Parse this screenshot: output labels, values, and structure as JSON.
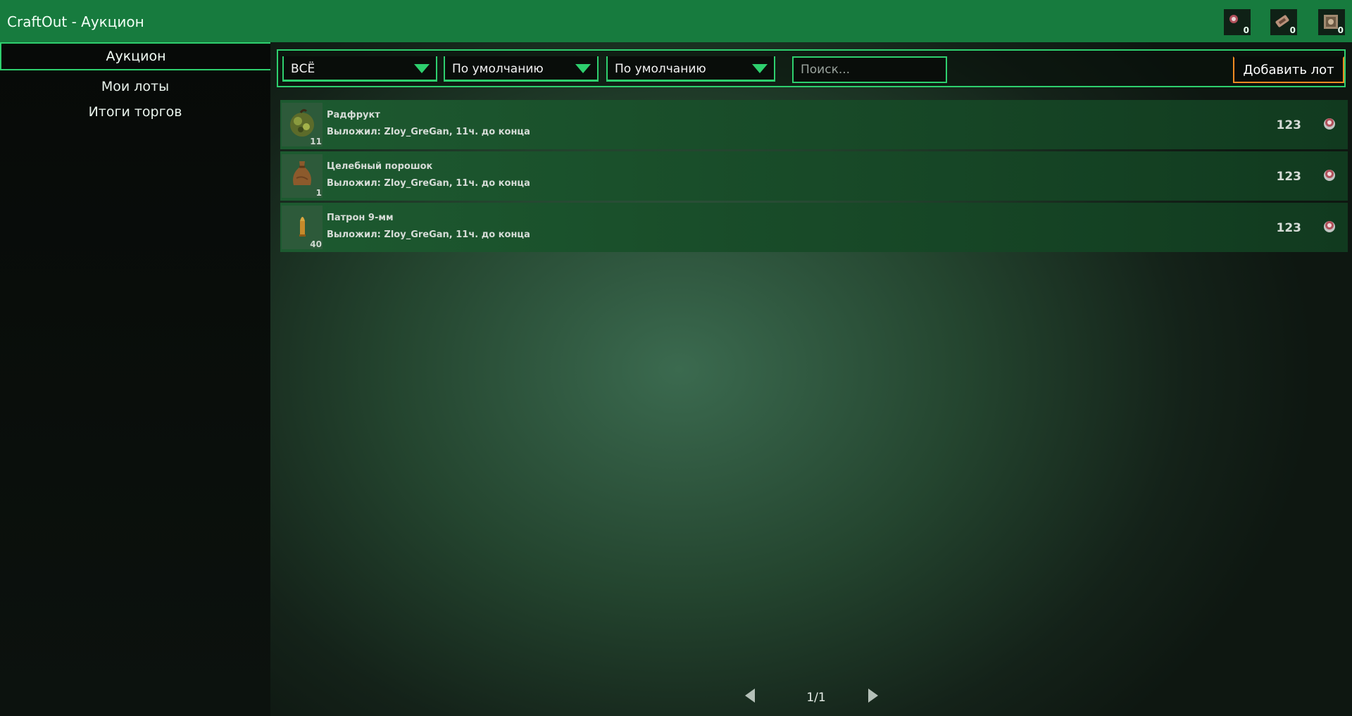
{
  "window": {
    "title": "CraftOut - Аукцион"
  },
  "currencies": [
    {
      "icon": "bottle-cap-icon",
      "count": "0"
    },
    {
      "icon": "ticket-icon",
      "count": "0"
    },
    {
      "icon": "crate-icon",
      "count": "0"
    }
  ],
  "sidebar": {
    "active_tab": "Аукцион",
    "items": [
      {
        "label": "Мои лоты"
      },
      {
        "label": "Итоги торгов"
      }
    ]
  },
  "filters": {
    "category": "ВСЁ",
    "sort1": "По умолчанию",
    "sort2": "По умолчанию",
    "search_placeholder": "Поиск...",
    "add_lot_label": "Добавить лот"
  },
  "lots": [
    {
      "name": "Радфрукт",
      "seller": "Выложил: Zloy_GreGan, 11ч. до конца",
      "qty": "11",
      "price": "123",
      "icon": "radfruit-icon"
    },
    {
      "name": "Целебный порошок",
      "seller": "Выложил: Zloy_GreGan, 11ч. до конца",
      "qty": "1",
      "price": "123",
      "icon": "powder-bag-icon"
    },
    {
      "name": "Патрон 9-мм",
      "seller": "Выложил: Zloy_GreGan, 11ч. до конца",
      "qty": "40",
      "price": "123",
      "icon": "bullet-icon"
    }
  ],
  "pagination": {
    "label": "1/1"
  },
  "colors": {
    "accent": "#2ecf6e",
    "titlebar": "#177b3e",
    "add_button_border": "#f08a22"
  }
}
